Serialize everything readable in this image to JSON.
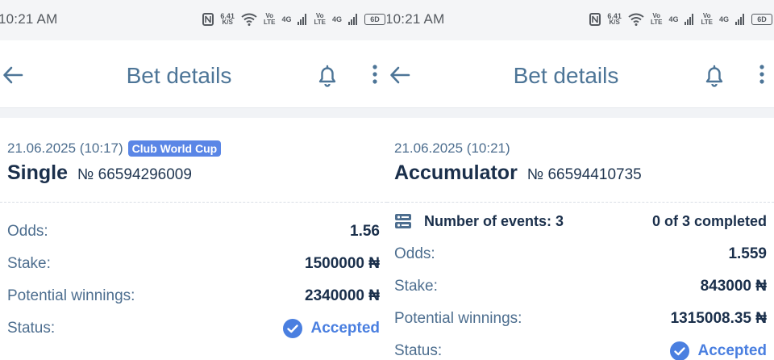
{
  "screens": [
    {
      "status_bar": {
        "time": "10:21 AM",
        "speed_value": "6.41",
        "speed_unit": "K/S",
        "sim1_tag": "Vo",
        "sim1_sub": "LTE",
        "sim2_tag": "Vo",
        "sim2_sub": "LTE",
        "net1": "4G",
        "net2": "4G",
        "battery": "6D"
      },
      "header": {
        "title": "Bet details"
      },
      "bet": {
        "datetime": "21.06.2025 (10:17)",
        "badge": "Club World Cup",
        "type": "Single",
        "number": "№ 66594296009",
        "rows": [
          {
            "label": "Odds:",
            "value": "1.56"
          },
          {
            "label": "Stake:",
            "value": "1500000 ₦"
          },
          {
            "label": "Potential winnings:",
            "value": "2340000 ₦"
          }
        ],
        "status_label": "Status:",
        "status_value": "Accepted"
      }
    },
    {
      "status_bar": {
        "time": "10:21 AM",
        "speed_value": "6.41",
        "speed_unit": "K/S",
        "sim1_tag": "Vo",
        "sim1_sub": "LTE",
        "sim2_tag": "Vo",
        "sim2_sub": "LTE",
        "net1": "4G",
        "net2": "4G",
        "battery": "6D"
      },
      "header": {
        "title": "Bet details"
      },
      "bet": {
        "datetime": "21.06.2025 (10:21)",
        "type": "Accumulator",
        "number": "№ 66594410735",
        "events_label": "Number of events: 3",
        "events_progress": "0 of 3 completed",
        "rows": [
          {
            "label": "Odds:",
            "value": "1.559"
          },
          {
            "label": "Stake:",
            "value": "843000 ₦"
          },
          {
            "label": "Potential winnings:",
            "value": "1315008.35 ₦"
          }
        ],
        "status_label": "Status:",
        "status_value": "Accepted"
      }
    }
  ],
  "colors": {
    "title": "#4d7597",
    "label": "#4d6e8f",
    "value": "#1a2f4b",
    "accent": "#4a7fe0",
    "badge": "#5a86e6"
  }
}
